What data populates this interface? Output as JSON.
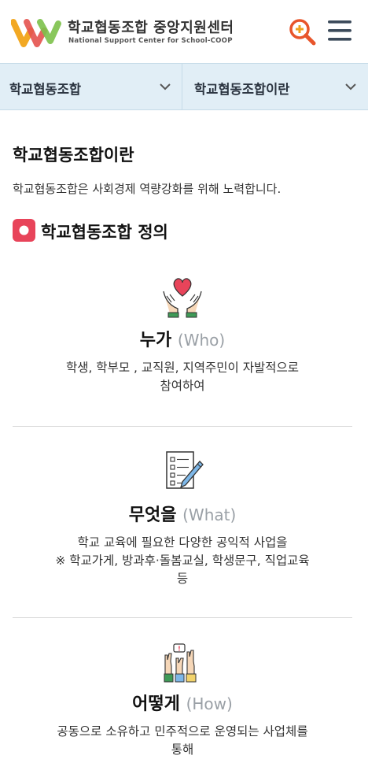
{
  "header": {
    "brand_ko": "학교협동조합 중앙지원센터",
    "brand_en": "National Support Center for School-COOP",
    "logo_colors": [
      "#f2a823",
      "#e4524e",
      "#7cc14a"
    ],
    "search_color": "#e8552b",
    "menu_color": "#3b4a5a"
  },
  "subnav": {
    "items": [
      {
        "label": "학교협동조합"
      },
      {
        "label": "학교협동조합이란"
      }
    ]
  },
  "main": {
    "title": "학교협동조합이란",
    "description": "학교협동조합은 사회경제 역량강화를 위해 노력합니다.",
    "section_title": "학교협동조합 정의",
    "cards": [
      {
        "icon": "hands-heart-icon",
        "title": "누가",
        "title_en": "(Who)",
        "lines": [
          "학생, 학부모 , 교직원, 지역주민이 자발적으로",
          "참여하여"
        ]
      },
      {
        "icon": "checklist-pencil-icon",
        "title": "무엇을",
        "title_en": "(What)",
        "lines": [
          "학교 교육에 필요한 다양한 공익적 사업을",
          "※ 학교가게, 방과후·돌봄교실, 학생문구, 직업교육",
          "등"
        ]
      },
      {
        "icon": "raised-hands-icon",
        "title": "어떻게",
        "title_en": "(How)",
        "lines": [
          "공동으로 소유하고 민주적으로 운영되는 사업체를",
          "통해"
        ]
      }
    ]
  }
}
